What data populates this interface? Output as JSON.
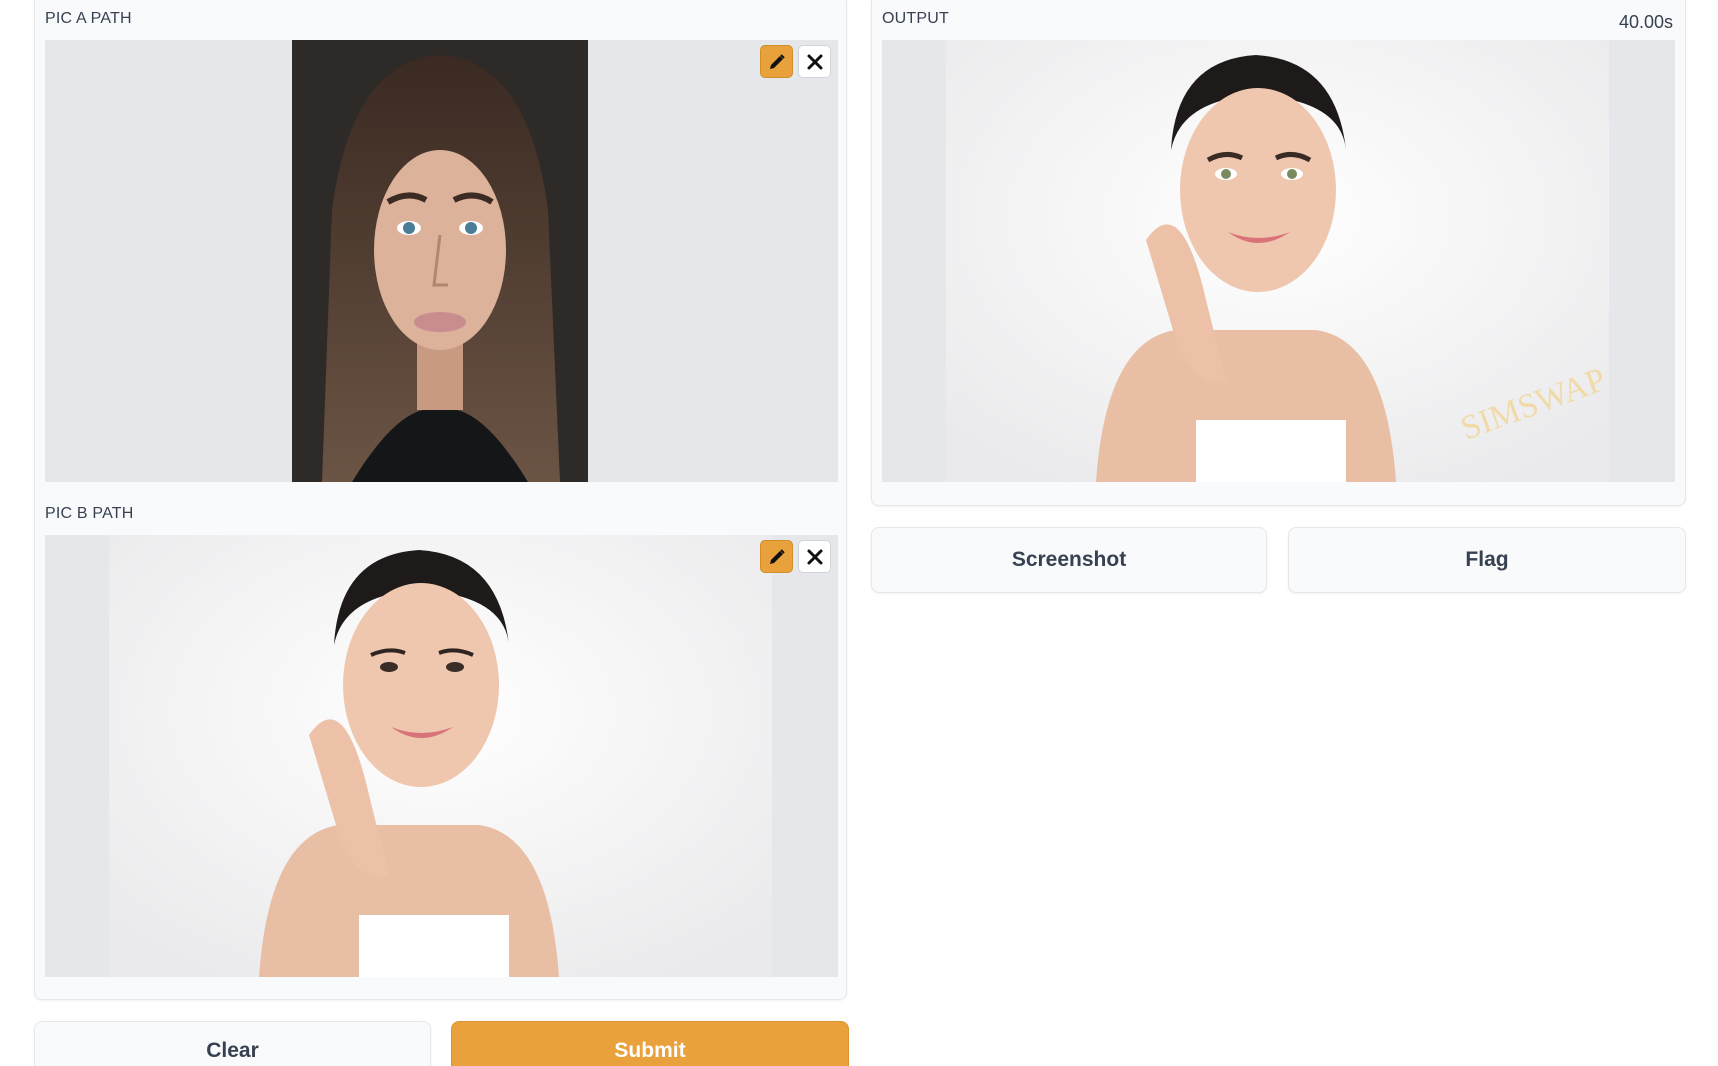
{
  "inputs": {
    "pic_a": {
      "label": "PIC A PATH"
    },
    "pic_b": {
      "label": "PIC B PATH"
    }
  },
  "output": {
    "label": "OUTPUT",
    "elapsed": "40.00s"
  },
  "buttons": {
    "clear": "Clear",
    "submit": "Submit",
    "screenshot": "Screenshot",
    "flag": "Flag"
  },
  "colors": {
    "accent": "#e9a13b",
    "panel_bg": "#f9fafb",
    "image_bg": "#e5e7eb"
  },
  "icons": {
    "edit": "pencil-icon",
    "remove": "close-icon"
  }
}
